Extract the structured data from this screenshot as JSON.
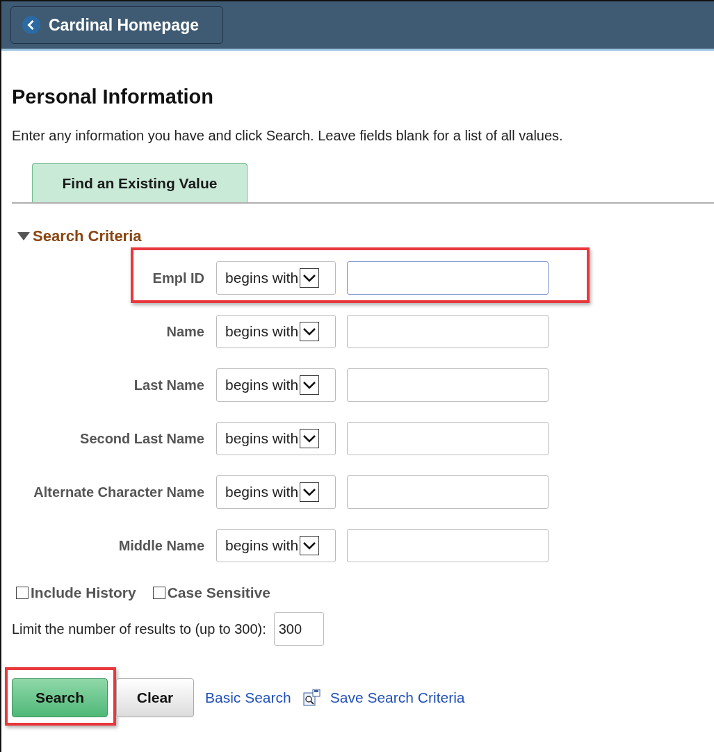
{
  "header": {
    "back_button": "Cardinal Homepage"
  },
  "title": "Personal Information",
  "instructions": "Enter any information you have and click Search. Leave fields blank for a list of all values.",
  "tabs": [
    {
      "label": "Find an Existing Value",
      "selected": true
    }
  ],
  "section": {
    "title": "Search Criteria"
  },
  "criteria": [
    {
      "label": "Empl ID",
      "operator": "begins with",
      "focused": true,
      "highlighted": true
    },
    {
      "label": "Name",
      "operator": "begins with",
      "focused": false,
      "highlighted": false
    },
    {
      "label": "Last Name",
      "operator": "begins with",
      "focused": false,
      "highlighted": false
    },
    {
      "label": "Second Last Name",
      "operator": "begins with",
      "focused": false,
      "highlighted": false
    },
    {
      "label": "Alternate Character Name",
      "operator": "begins with",
      "focused": false,
      "highlighted": false
    },
    {
      "label": "Middle Name",
      "operator": "begins with",
      "focused": false,
      "highlighted": false
    }
  ],
  "options": [
    {
      "label": "Include History",
      "checked": false
    },
    {
      "label": "Case Sensitive",
      "checked": false
    }
  ],
  "limit": {
    "label": "Limit the number of results to (up to 300):",
    "value": "300"
  },
  "buttons": [
    {
      "label": "Search",
      "kind": "primary",
      "highlighted": true
    },
    {
      "label": "Clear",
      "kind": "secondary",
      "highlighted": false
    }
  ],
  "links": [
    {
      "label": "Basic Search",
      "icon": false
    },
    {
      "label": "Save Search Criteria",
      "icon": true
    }
  ]
}
